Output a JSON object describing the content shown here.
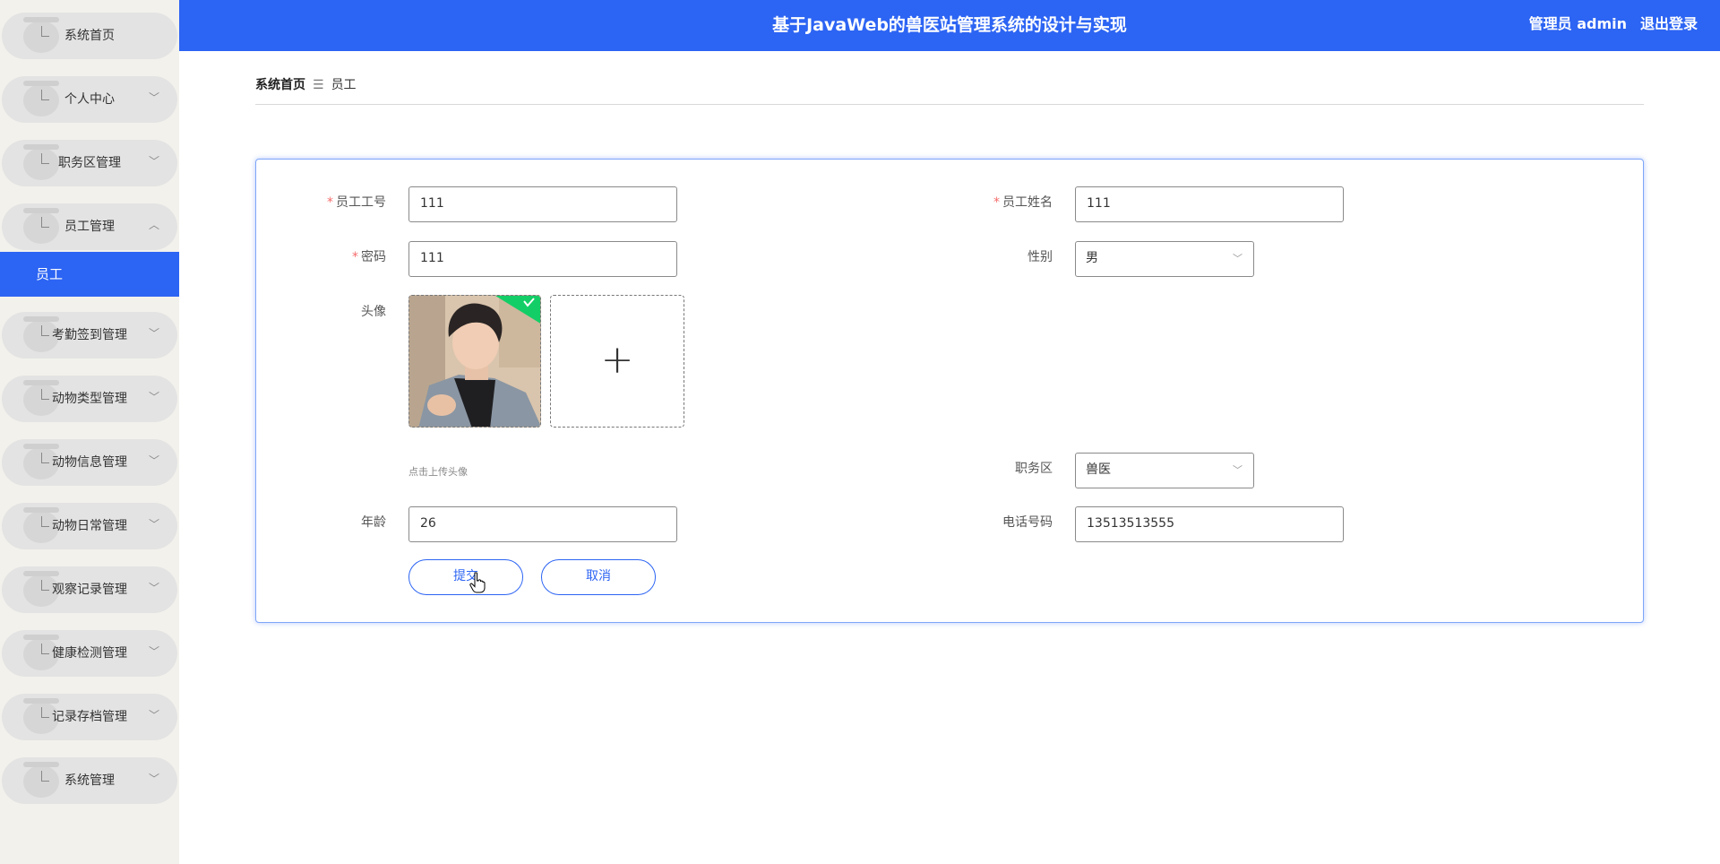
{
  "app": {
    "title": "基于JavaWeb的兽医站管理系统的设计与实现",
    "user": "管理员 admin",
    "logout": "退出登录"
  },
  "sidebar": {
    "items": [
      {
        "label": "系统首页",
        "chevron": ""
      },
      {
        "label": "个人中心",
        "chevron": "﹀"
      },
      {
        "label": "职务区管理",
        "chevron": "﹀"
      },
      {
        "label": "员工管理",
        "chevron": "︿"
      },
      {
        "label": "考勤签到管理",
        "chevron": "﹀"
      },
      {
        "label": "动物类型管理",
        "chevron": "﹀"
      },
      {
        "label": "动物信息管理",
        "chevron": "﹀"
      },
      {
        "label": "动物日常管理",
        "chevron": "﹀"
      },
      {
        "label": "观察记录管理",
        "chevron": "﹀"
      },
      {
        "label": "健康检测管理",
        "chevron": "﹀"
      },
      {
        "label": "记录存档管理",
        "chevron": "﹀"
      },
      {
        "label": "系统管理",
        "chevron": "﹀"
      }
    ],
    "active_sub": "员工"
  },
  "breadcrumb": {
    "home": "系统首页",
    "sep": "☰",
    "current": "员工"
  },
  "form": {
    "required_mark": "*",
    "employee_no": {
      "label": "员工工号",
      "value": "111"
    },
    "employee_name": {
      "label": "员工姓名",
      "value": "111"
    },
    "password": {
      "label": "密码",
      "value": "111"
    },
    "gender": {
      "label": "性别",
      "value": "男"
    },
    "avatar": {
      "label": "头像",
      "hint": "点击上传头像",
      "add": "+"
    },
    "department": {
      "label": "职务区",
      "value": "兽医"
    },
    "age": {
      "label": "年龄",
      "value": "26"
    },
    "phone": {
      "label": "电话号码",
      "value": "13513513555"
    },
    "submit": "提交",
    "cancel": "取消"
  },
  "colors": {
    "primary": "#2c64f3",
    "required": "#f56c6c",
    "success": "#13ce66"
  },
  "icons": {
    "select_arrow": "﹀"
  }
}
